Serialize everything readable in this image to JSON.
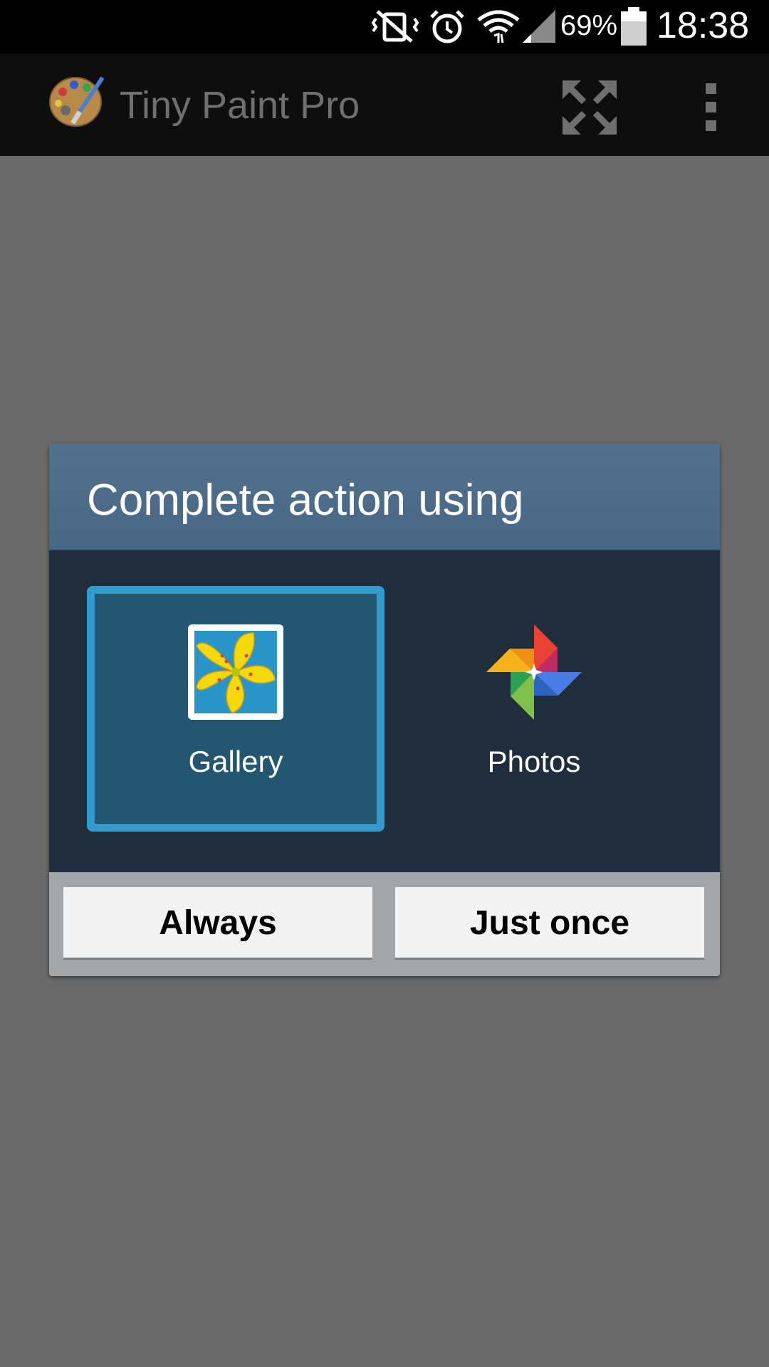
{
  "status_bar": {
    "battery_percent": "69%",
    "time": "18:38",
    "icons": [
      "vibrate-off-icon",
      "alarm-icon",
      "wifi-icon",
      "signal-icon",
      "battery-icon"
    ]
  },
  "action_bar": {
    "title": "Tiny Paint Pro",
    "icons": [
      "palette-app-icon",
      "fullscreen-icon",
      "overflow-menu-icon"
    ]
  },
  "dialog": {
    "title": "Complete action using",
    "options": [
      {
        "label": "Gallery",
        "icon": "gallery-icon",
        "selected": true
      },
      {
        "label": "Photos",
        "icon": "photos-pinwheel-icon",
        "selected": false
      }
    ],
    "buttons": {
      "always": "Always",
      "just_once": "Just once"
    }
  },
  "colors": {
    "selection_border": "#2f9ccd",
    "dialog_header": "#4d6c89",
    "dialog_body": "#1f2d3c",
    "scrim": "#6a6a6a"
  }
}
